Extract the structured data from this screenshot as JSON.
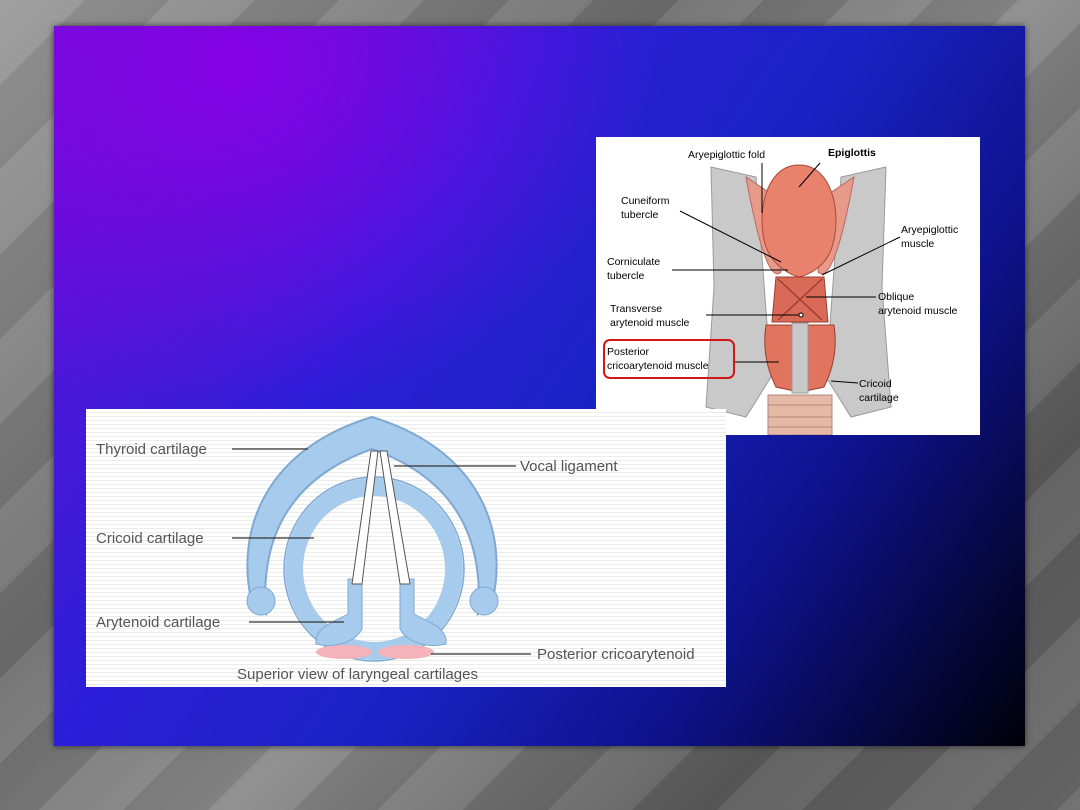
{
  "fig_top": {
    "labels": {
      "aryepiglottic_fold": "Aryepiglottic fold",
      "epiglottis": "Epiglottis",
      "cuneiform_1": "Cuneiform",
      "cuneiform_2": "tubercle",
      "aryepiglottic_muscle_1": "Aryepiglottic",
      "aryepiglottic_muscle_2": "muscle",
      "corniculate_1": "Corniculate",
      "corniculate_2": "tubercle",
      "oblique_1": "Oblique",
      "oblique_2": "arytenoid muscle",
      "transverse_1": "Transverse",
      "transverse_2": "arytenoid muscle",
      "posterior_1": "Posterior",
      "posterior_2": "cricoarytenoid muscle",
      "cricoid_1": "Cricoid",
      "cricoid_2": "cartilage"
    },
    "highlight_color": "#d01818",
    "muscle_color": "#e0745e"
  },
  "fig_bottom": {
    "labels": {
      "thyroid": "Thyroid cartilage",
      "vocal": "Vocal ligament",
      "cricoid": "Cricoid cartilage",
      "arytenoid": "Arytenoid cartilage",
      "posterior": "Posterior cricoarytenoid"
    },
    "caption": "Superior view of laryngeal cartilages",
    "cartilage_color": "#a7cbec"
  }
}
